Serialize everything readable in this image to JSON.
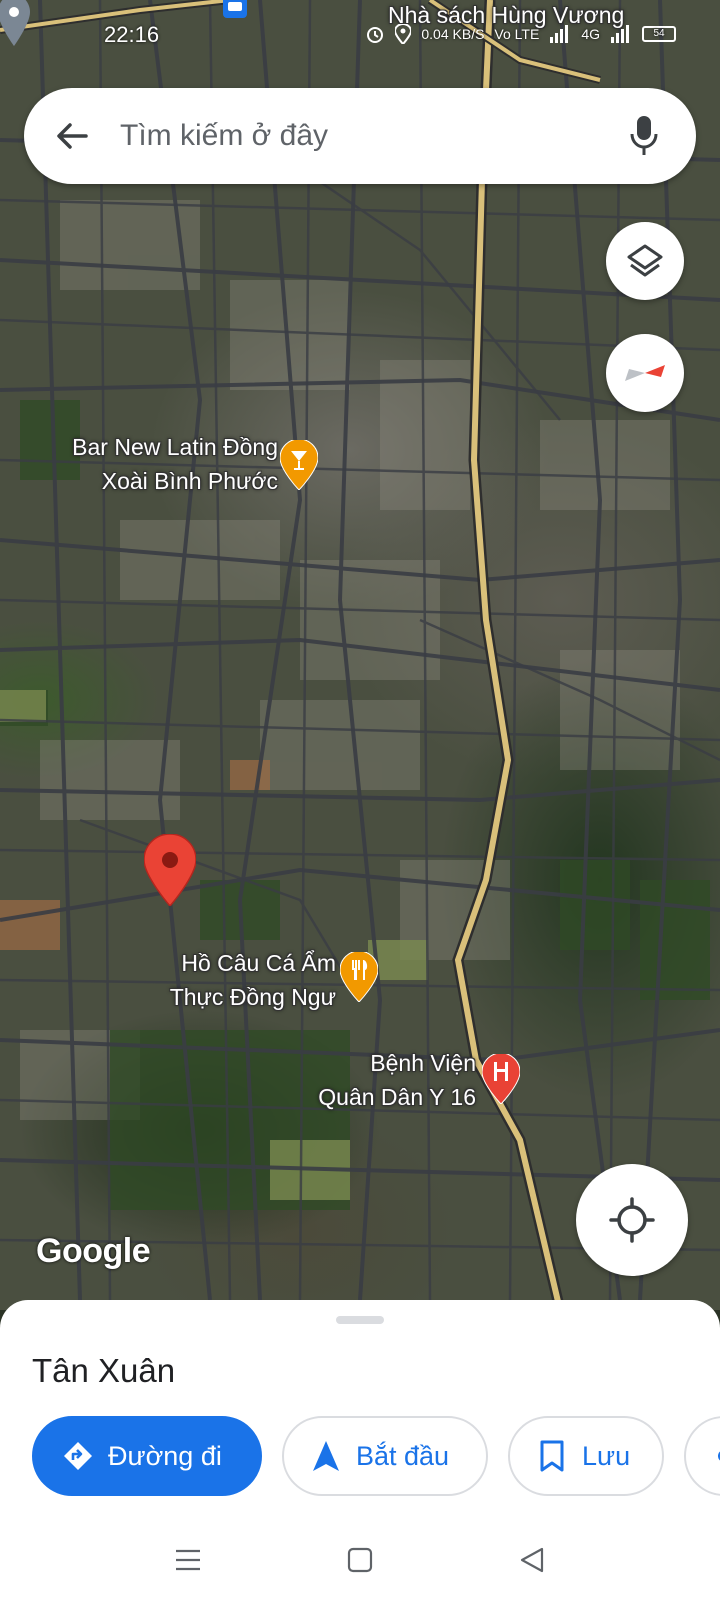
{
  "status_bar": {
    "time": "22:16",
    "net_speed": "0.04 KB/S",
    "network_type": "4G",
    "volte": "Vo LTE",
    "battery": "54"
  },
  "search": {
    "placeholder": "Tìm kiếm ở đây"
  },
  "map": {
    "labels": {
      "bookstore": "Nhà sách Hùng Vương",
      "bar_line1": "Bar New Latin Đồng",
      "bar_line2": "Xoài Bình Phước",
      "fishing_line1": "Hồ Câu Cá Ẩm",
      "fishing_line2": "Thực Đồng Ngư",
      "hospital_line1": "Bệnh Viện",
      "hospital_line2": "Quân Dân Y 16"
    },
    "attribution": "Google",
    "icons": {
      "bar": "cocktail-icon",
      "restaurant": "fork-knife-icon",
      "hospital": "hospital-icon",
      "selected": "red-pin-icon"
    },
    "colors": {
      "poi_orange": "#F29900",
      "hospital_red": "#E94235",
      "pin_red": "#EA4335",
      "main_road": "#D9C07A"
    }
  },
  "place": {
    "title": "Tân Xuân"
  },
  "actions": {
    "directions": "Đường đi",
    "start": "Bắt đầu",
    "save": "Lưu"
  },
  "theme": {
    "accent": "#1A73E8"
  }
}
